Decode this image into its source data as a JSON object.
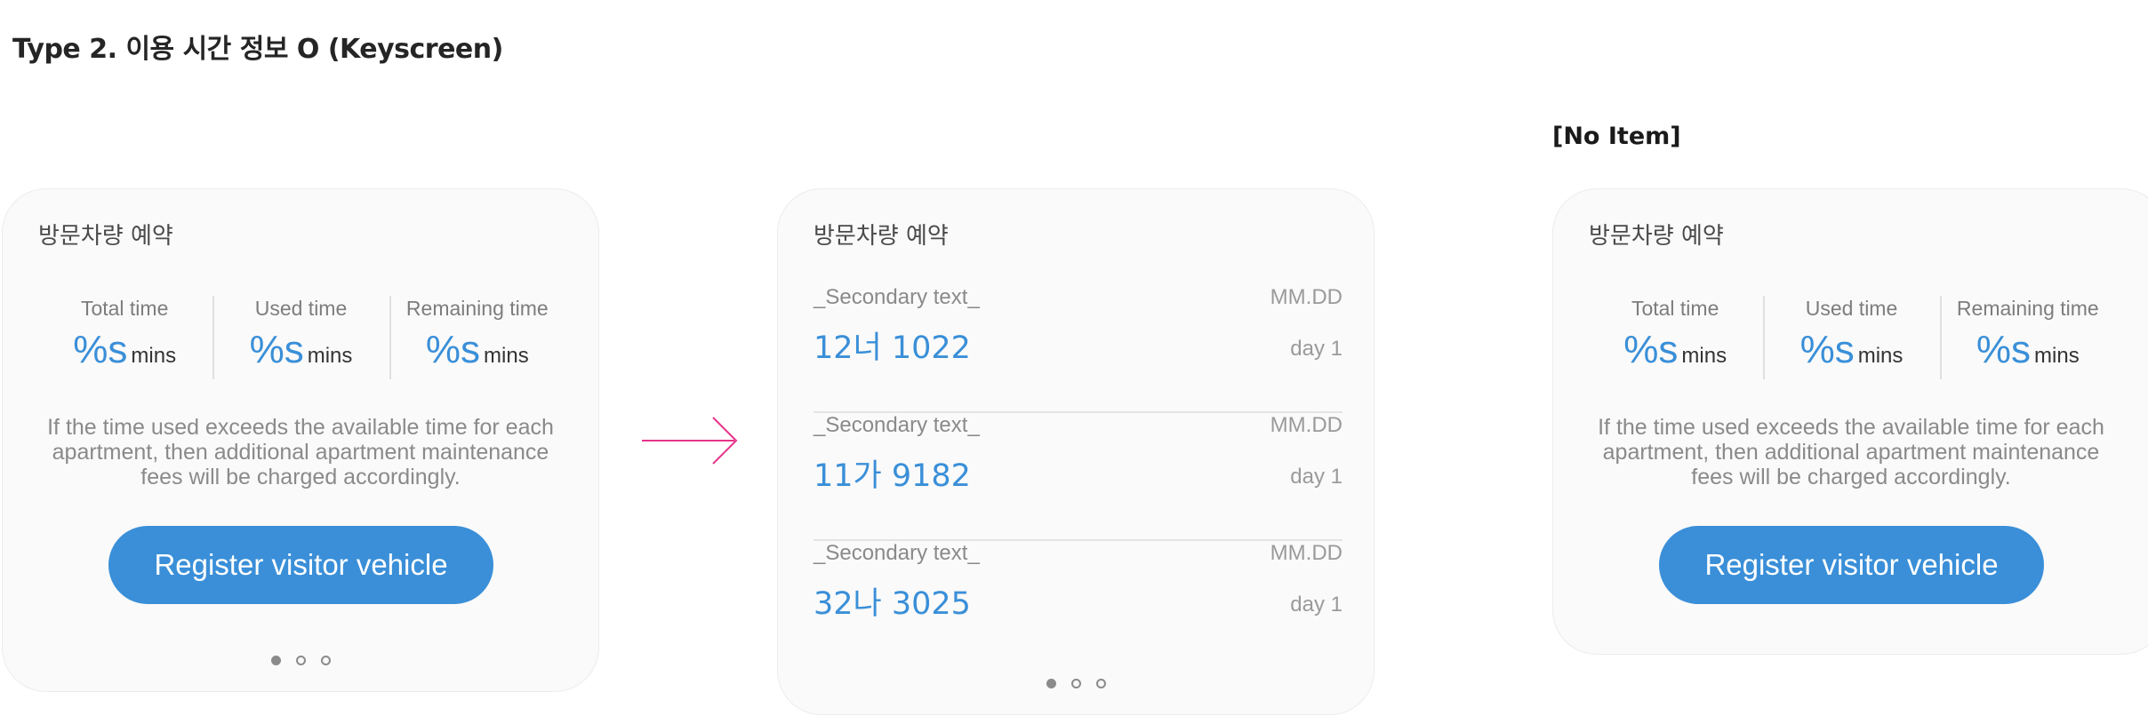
{
  "page_title": "Type 2. 이용 시간 정보 O (Keyscreen)",
  "no_item_label": "[No Item]",
  "colors": {
    "accent": "#3a8fd8",
    "arrow": "#e8338a",
    "card_bg": "#fafafa"
  },
  "cards": {
    "left": {
      "header": "방문차량 예약",
      "stats": [
        {
          "label": "Total time",
          "value": "%s",
          "unit": "mins"
        },
        {
          "label": "Used time",
          "value": "%s",
          "unit": "mins"
        },
        {
          "label": "Remaining time",
          "value": "%s",
          "unit": "mins"
        }
      ],
      "notice": "If the time used exceeds the available time for each apartment, then additional apartment maintenance fees will be charged accordingly.",
      "button": "Register visitor vehicle",
      "page_indicator": {
        "total": 3,
        "active": 1
      }
    },
    "middle": {
      "header": "방문차량 예약",
      "items": [
        {
          "secondary": "_Secondary text_",
          "plate": "12너 1022",
          "date": "MM.DD",
          "day": "day 1"
        },
        {
          "secondary": "_Secondary text_",
          "plate": "11가 9182",
          "date": "MM.DD",
          "day": "day 1"
        },
        {
          "secondary": "_Secondary text_",
          "plate": "32나 3025",
          "date": "MM.DD",
          "day": "day 1"
        }
      ],
      "page_indicator": {
        "total": 3,
        "active": 1
      }
    },
    "right": {
      "header": "방문차량 예약",
      "stats": [
        {
          "label": "Total time",
          "value": "%s",
          "unit": "mins"
        },
        {
          "label": "Used time",
          "value": "%s",
          "unit": "mins"
        },
        {
          "label": "Remaining time",
          "value": "%s",
          "unit": "mins"
        }
      ],
      "notice": "If the time used exceeds the available time for each apartment, then additional apartment maintenance fees will be charged accordingly.",
      "button": "Register visitor vehicle"
    }
  },
  "icons": {
    "flow_arrow": "arrow-right-icon"
  }
}
